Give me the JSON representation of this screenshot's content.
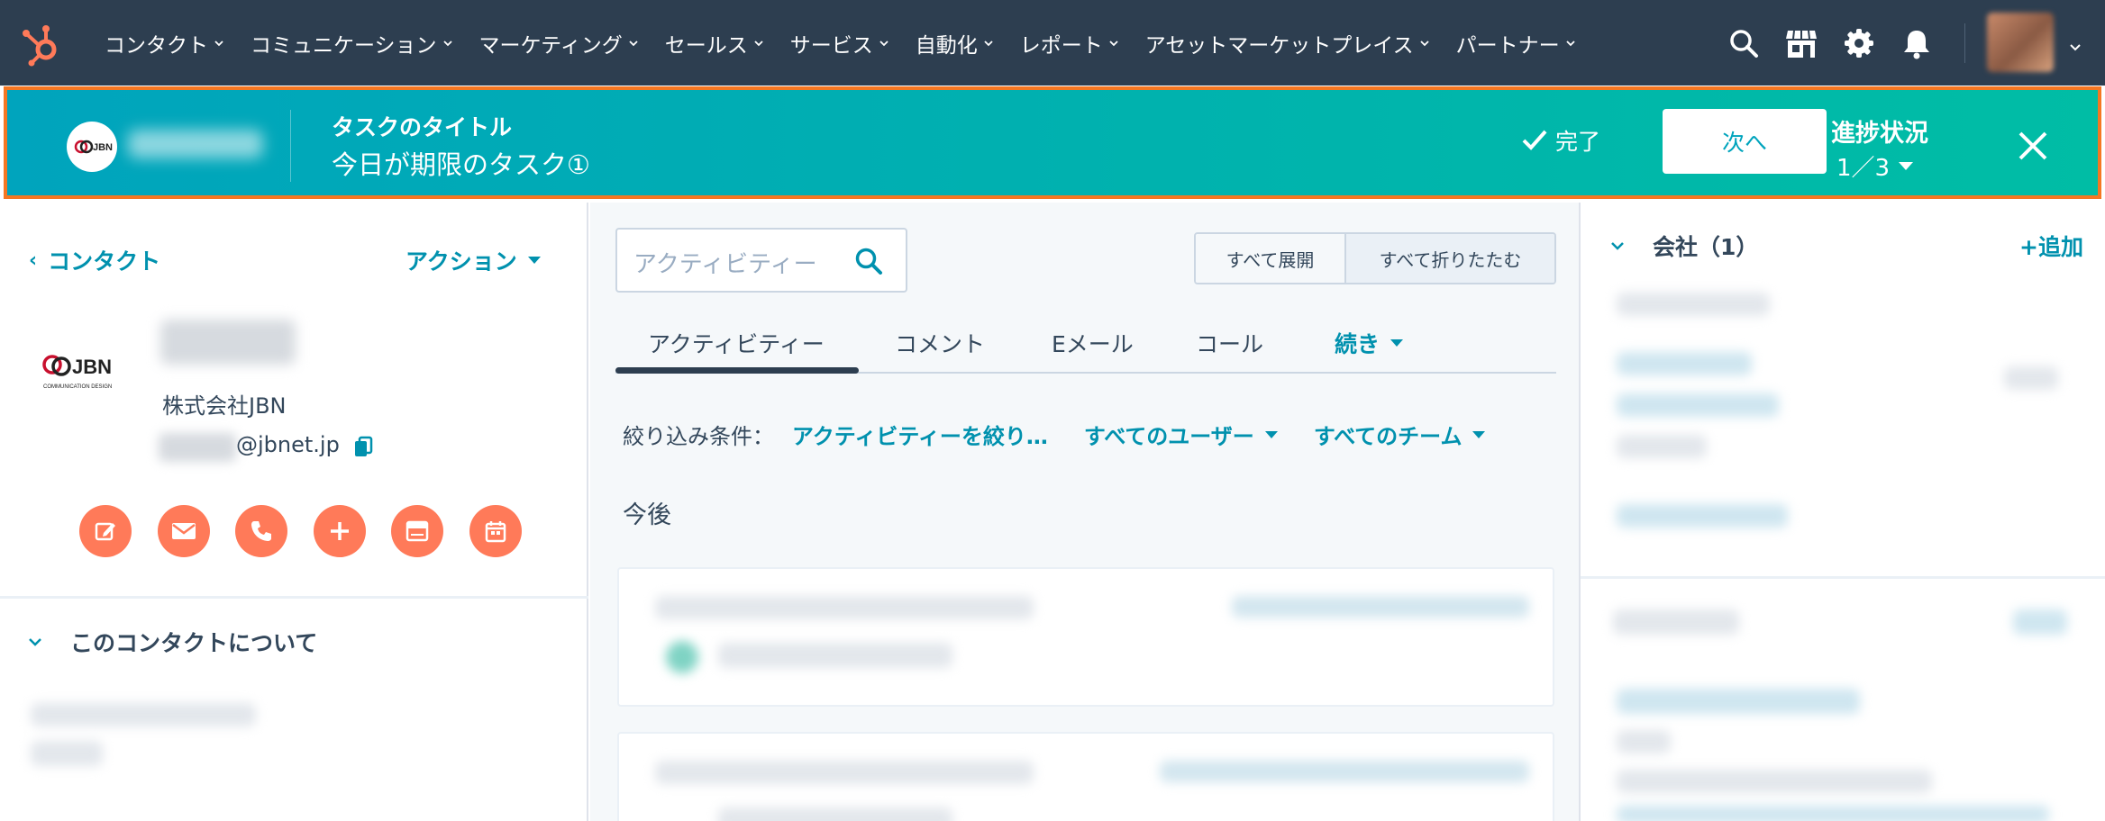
{
  "nav": {
    "items": [
      {
        "label": "コンタクト"
      },
      {
        "label": "コミュニケーション"
      },
      {
        "label": "マーケティング"
      },
      {
        "label": "セールス"
      },
      {
        "label": "サービス"
      },
      {
        "label": "自動化"
      },
      {
        "label": "レポート"
      },
      {
        "label": "アセットマーケットプレイス"
      },
      {
        "label": "パートナー"
      }
    ],
    "icons": [
      "hubspot-logo-icon",
      "search-icon",
      "marketplace-icon",
      "gear-icon",
      "bell-icon",
      "avatar",
      "chevron-down-icon"
    ]
  },
  "task_banner": {
    "label": "タスクのタイトル",
    "title": "今日が期限のタスク①",
    "done_label": "完了",
    "next_label": "次へ",
    "progress_label": "進捗状況",
    "progress_value": "1／3",
    "color_start": "#00a4bd",
    "color_end": "#00bda5",
    "border_color": "#f57722"
  },
  "contact": {
    "back_label": "コンタクト",
    "actions_label": "アクション",
    "company": "株式会社JBN",
    "email_domain": "@jbnet.jp",
    "logo_text": "JBN",
    "logo_subtext": "COMMUNICATION DESIGN",
    "quick_actions": [
      "note-icon",
      "email-icon",
      "call-icon",
      "add-icon",
      "meeting-icon",
      "calendar-icon"
    ],
    "about_label": "このコンタクトについて",
    "accent_color": "#ff7a59"
  },
  "activity": {
    "search_placeholder": "アクティビティー",
    "expand_all": "すべて展開",
    "collapse_all": "すべて折りたたむ",
    "tabs": [
      {
        "label": "アクティビティー"
      },
      {
        "label": "コメント"
      },
      {
        "label": "Eメール"
      },
      {
        "label": "コール"
      }
    ],
    "more_label": "続き",
    "filter_label": "絞り込み条件：",
    "filter_activity": "アクティビティーを絞り…",
    "filter_users": "すべてのユーザー",
    "filter_teams": "すべてのチーム",
    "upcoming_label": "今後"
  },
  "right_panel": {
    "company_header": "会社（1）",
    "add_label": "+追加"
  }
}
